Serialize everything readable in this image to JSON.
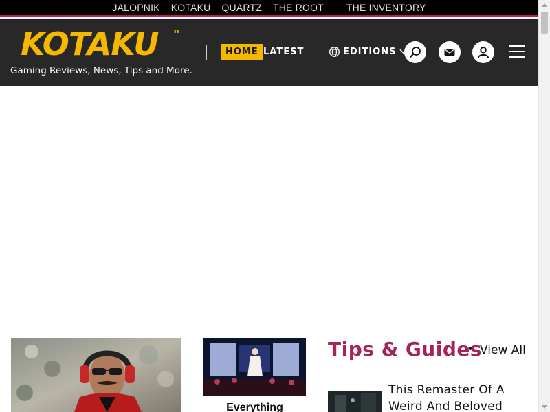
{
  "network_bar": {
    "links": [
      "JALOPNIK",
      "KOTAKU",
      "QUARTZ",
      "THE ROOT"
    ],
    "trailing_link": "THE INVENTORY",
    "accent_color": "#c2185b"
  },
  "header": {
    "logo_text": "KOTAKU",
    "tagline": "Gaming Reviews, News, Tips and More.",
    "nav": {
      "home_label": "HOME",
      "latest_label": "LATEST",
      "editions_label": "EDITIONS"
    },
    "icons": {
      "globe": "globe-icon",
      "chevron": "chevron-down-icon",
      "search": "search-icon",
      "mail": "mail-icon",
      "account": "user-icon",
      "menu": "hamburger-menu-icon"
    },
    "brand_color": "#f5b800",
    "background": "#282828"
  },
  "content": {
    "small_story_title": "Everything",
    "tips_section": {
      "title": "Tips & Guides",
      "view_all_label": "View All",
      "color": "#a6235a"
    },
    "guide_item_title": "This Remaster Of A Weird And Beloved"
  }
}
